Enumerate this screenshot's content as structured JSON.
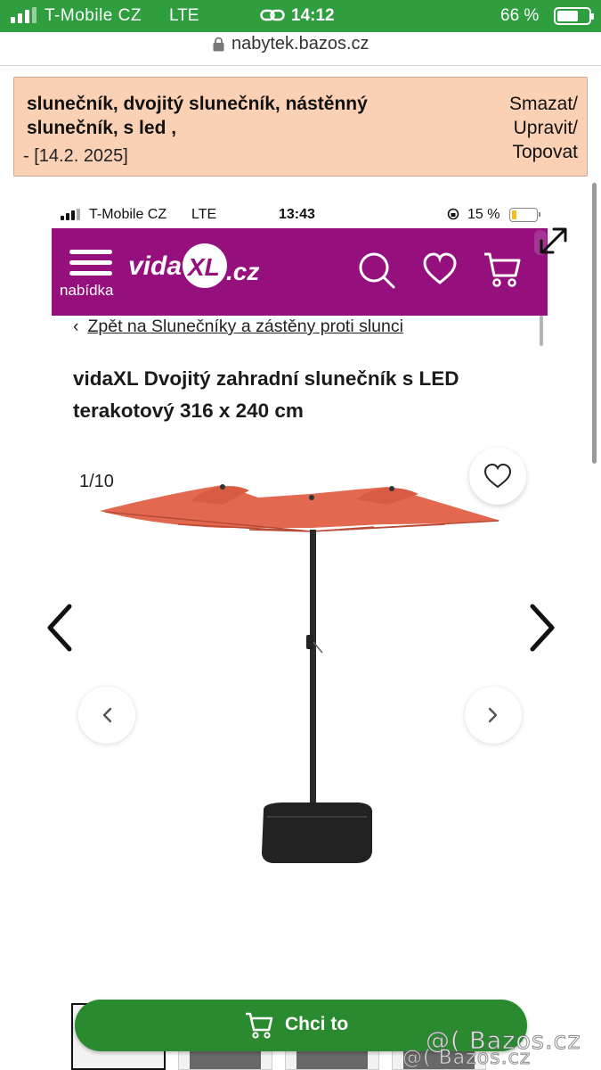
{
  "status_bar": {
    "carrier": "T-Mobile CZ",
    "network": "LTE",
    "time": "14:12",
    "battery": "66 %"
  },
  "browser": {
    "url": "nabytek.bazos.cz"
  },
  "ad_header": {
    "title": "slunečník, dvojitý slunečník, nástěnný slunečník, s led ,",
    "date": "- [14.2. 2025]",
    "actions": [
      "Smazat/",
      "Upravit/",
      "Topovat"
    ]
  },
  "inner_status_bar": {
    "carrier": "T-Mobile CZ",
    "network": "LTE",
    "time": "13:43",
    "battery": "15 %"
  },
  "vidaxl_header": {
    "menu_label": "nabídka",
    "logo_text": "vidaXL.cz",
    "brand_color": "#950f7d"
  },
  "breadcrumb": {
    "chevron": "‹",
    "text": "Zpět na Slunečníky a zástěny proti slunci"
  },
  "product": {
    "title": "vidaXL Dvojitý zahradní slunečník s LED terakotový 316 x 240 cm",
    "image_counter": "1/10",
    "canopy_color": "#e2694f"
  },
  "cta": {
    "label": "Chci to",
    "color": "#2a8a30"
  },
  "watermark": {
    "line1": "@( Bazos.cz",
    "line2": "@( Bazos.cz"
  },
  "icons": [
    "signal-icon",
    "link-icon",
    "battery-icon",
    "lock-icon",
    "menu-icon",
    "search-icon",
    "heart-icon",
    "cart-icon",
    "expand-icon",
    "chevron-left-icon",
    "chevron-right-icon"
  ]
}
